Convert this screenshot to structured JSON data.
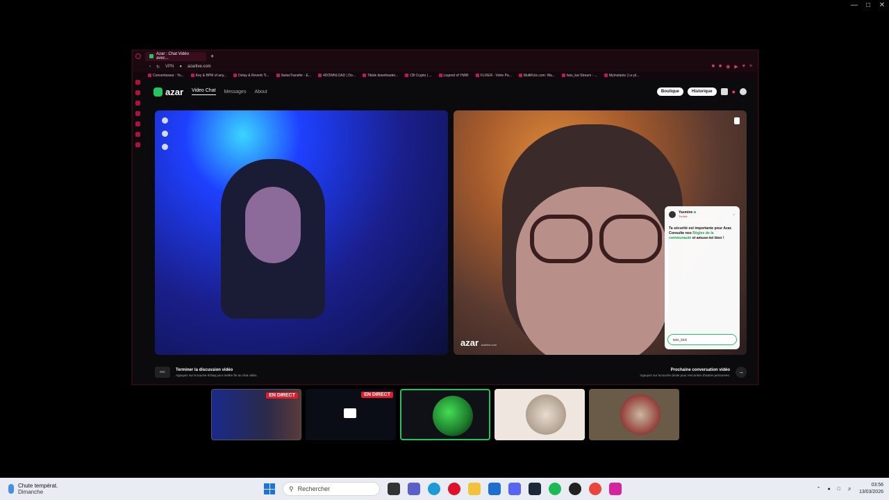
{
  "browser": {
    "tab_title": "Azar : Chat Vidéo avec...",
    "new_tab": "+",
    "vpn": "VPN",
    "url": "azarlive.com",
    "bookmarks": [
      "Convertisseur : Yo...",
      "Key & BPM of any...",
      "Delay & Reverb Ti...",
      "SwissTransfer - E...",
      "4DOWNLOAD | Do...",
      "Tiktok downloader...",
      "CB Crypto | ...",
      "Legend of YMIR",
      "FLIXER - Votre Pa...",
      "MultiKick.com: Wa...",
      "twis_kai Stream - ...",
      "MyInstants | Le pl..."
    ]
  },
  "app": {
    "logo": "azar",
    "nav": [
      "Video Chat",
      "Messages",
      "About"
    ],
    "boutique": "Boutique",
    "historique": "Historique"
  },
  "remote_video": {
    "watermark": "azar",
    "watermark_sub": "azarlive.com"
  },
  "chat": {
    "username": "Yasmine",
    "sub": "Tunisie",
    "message_pre": "Ta sécurité est importante pour Azar. Consulte nos ",
    "message_link": "Règles de la communauté",
    "message_post": " et amuse-toi bien !",
    "input_value": "twis_kick"
  },
  "footer": {
    "esc": "esc",
    "left_title": "Terminer la discussion vidéo",
    "left_sub": "Appuyez sur la touche échap pour mettre fin au chat vidéo.",
    "right_title": "Prochaine conversation vidéo",
    "right_sub": "Appuyez sur la touche droite pour rencontrer d'autres personnes."
  },
  "switcher": {
    "live_label": "EN DIRECT"
  },
  "taskbar": {
    "weather_title": "Chute températ.",
    "weather_sub": "Dimanche",
    "search_placeholder": "Rechercher",
    "time": "03:56",
    "date": "13/03/2026"
  }
}
